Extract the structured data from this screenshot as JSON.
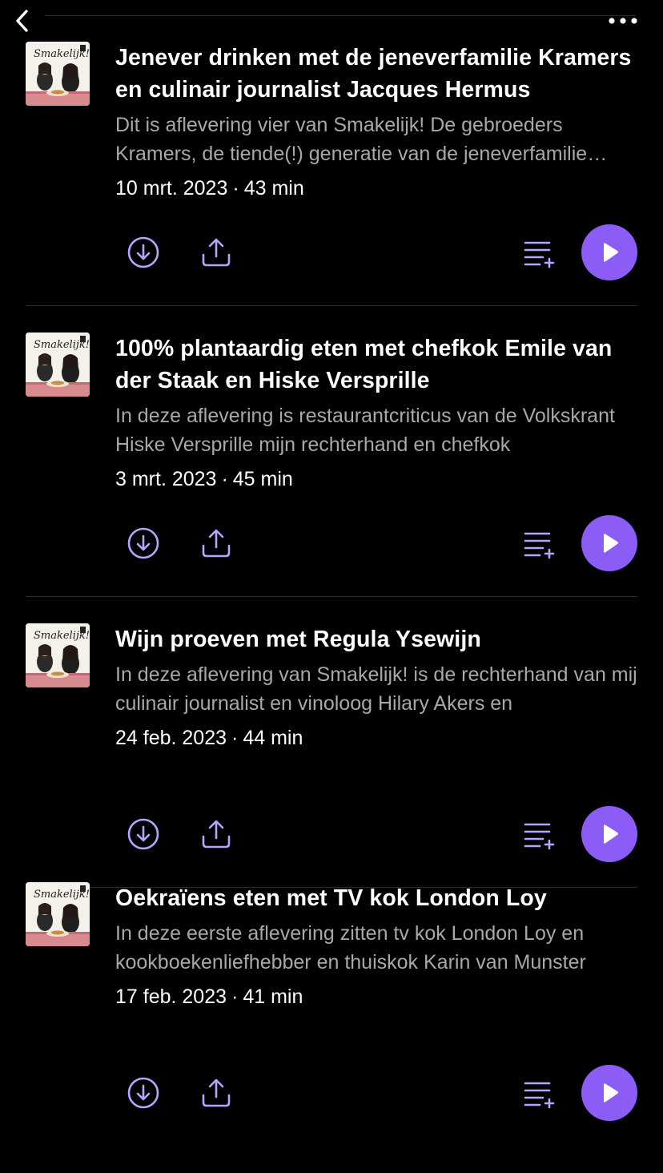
{
  "header": {
    "back_icon": "chevron-left-icon",
    "more_icon": "more-horizontal-icon"
  },
  "colors": {
    "background": "#000000",
    "accent": "#8b5cf6",
    "icon": "#b7a4ff",
    "secondary_text": "#a8a8a8"
  },
  "cover_art": {
    "text": "Smakelijk!",
    "icon": "podcast-cover-art"
  },
  "episodes": [
    {
      "title": "Jenever drinken met de jeneverfamilie Kramers en culinair journalist Jacques Hermus",
      "description": "Dit is aflevering vier van Smakelijk! De gebroeders Kramers, de tiende(!) generatie van de jeneverfamilie Kramers",
      "date": "10 mrt. 2023",
      "separator": "·",
      "duration": "43 min"
    },
    {
      "title": "100% plantaardig eten met chefkok Emile van der Staak en Hiske Versprille",
      "description": "In deze aflevering is restaurantcriticus van de Volkskrant Hiske Versprille mijn rechterhand en chefkok",
      "date": "3 mrt. 2023",
      "separator": "·",
      "duration": "45 min"
    },
    {
      "title": "Wijn proeven met Regula Ysewijn",
      "description": "In deze aflevering van Smakelijk! is de rechterhand van mij culinair journalist en vinoloog Hilary Akers en",
      "date": "24 feb. 2023",
      "separator": "·",
      "duration": "44 min"
    },
    {
      "title": "Oekraïens eten met TV kok London Loy",
      "description": "In deze eerste aflevering zitten tv kok London Loy en kookboekenliefhebber en thuiskok Karin van Munster",
      "date": "17 feb. 2023",
      "separator": "·",
      "duration": "41 min"
    }
  ],
  "actions": {
    "download_icon": "download-icon",
    "share_icon": "share-icon",
    "queue_icon": "add-to-queue-icon",
    "play_icon": "play-icon"
  }
}
